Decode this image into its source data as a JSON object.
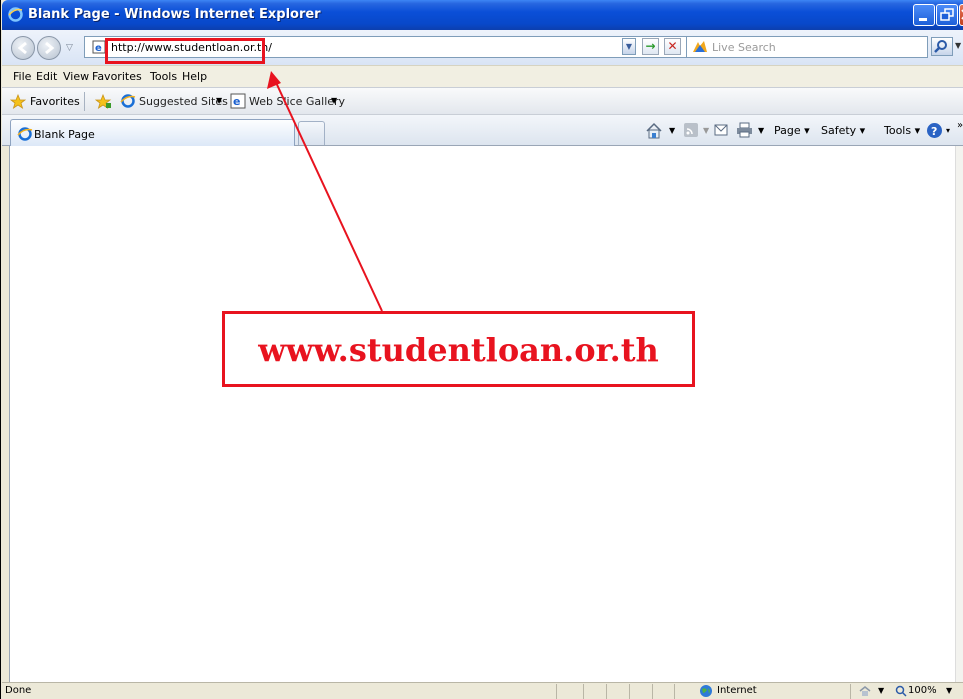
{
  "window": {
    "title": "Blank Page - Windows Internet Explorer"
  },
  "address_bar": {
    "url": "http://www.studentloan.or.th/",
    "search_placeholder": "Live Search"
  },
  "menu": {
    "items": [
      "File",
      "Edit",
      "View",
      "Favorites",
      "Tools",
      "Help"
    ]
  },
  "favorites_bar": {
    "favorites_label": "Favorites",
    "suggested_sites": "Suggested Sites",
    "web_slice_gallery": "Web Slice Gallery"
  },
  "tabs": {
    "active_label": "Blank Page"
  },
  "command_bar": {
    "page": "Page",
    "safety": "Safety",
    "tools": "Tools"
  },
  "status_bar": {
    "status": "Done",
    "zone": "Internet",
    "zoom": "100%"
  },
  "annotation": {
    "callout_text": "www.studentloan.or.th",
    "color": "#e8131f"
  },
  "icons": {
    "browser": "ie-icon",
    "back": "back-arrow-icon",
    "forward": "forward-arrow-icon",
    "go": "go-arrow-icon",
    "stop": "stop-x-icon",
    "search": "magnifier-icon",
    "favorites": "star-icon",
    "home": "home-icon",
    "feeds": "rss-icon",
    "mail": "mail-icon",
    "print": "printer-icon",
    "help": "help-icon",
    "zone": "globe-icon"
  }
}
